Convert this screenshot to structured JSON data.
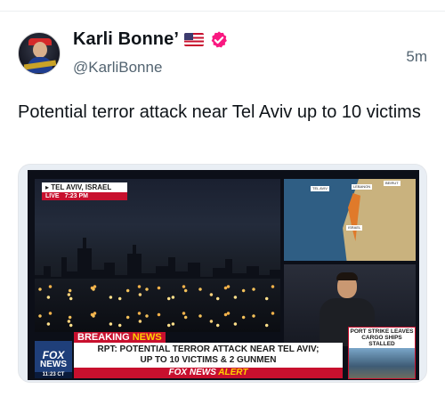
{
  "author": {
    "display_name": "Karli Bonne’",
    "handle": "@KarliBonne",
    "avatar_caption": "MAGA"
  },
  "timestamp": "5m",
  "tweet": {
    "text": "Potential terror attack near Tel Aviv up to 10 victims"
  },
  "broadcast": {
    "location": "TEL AVIV, ISRAEL",
    "live_label": "LIVE",
    "live_time": "7:23 PM",
    "map_labels": [
      "TEL AVIV",
      "LEBANON",
      "BEIRUT",
      "ISRAEL"
    ],
    "side_box": "PORT STRIKE LEAVES CARGO SHIPS STALLED",
    "breaking_white": "BREAKING",
    "breaking_yellow": "NEWS",
    "headline_line1": "RPT: POTENTIAL TERROR ATTACK NEAR TEL AVIV;",
    "headline_line2": "UP TO 10 VICTIMS & 2 GUNMEN",
    "alert_white": "FOX NEWS",
    "alert_yellow": "ALERT",
    "logo_top": "FOX",
    "logo_bottom": "NEWS",
    "logo_time": "11:23 CT"
  },
  "colors": {
    "verified_badge": "#f91880",
    "fox_red": "#c8102e",
    "fox_blue": "#1f3f7a",
    "secondary_text": "#536471"
  },
  "icons": [
    "verified-badge-icon",
    "us-flag-icon"
  ]
}
